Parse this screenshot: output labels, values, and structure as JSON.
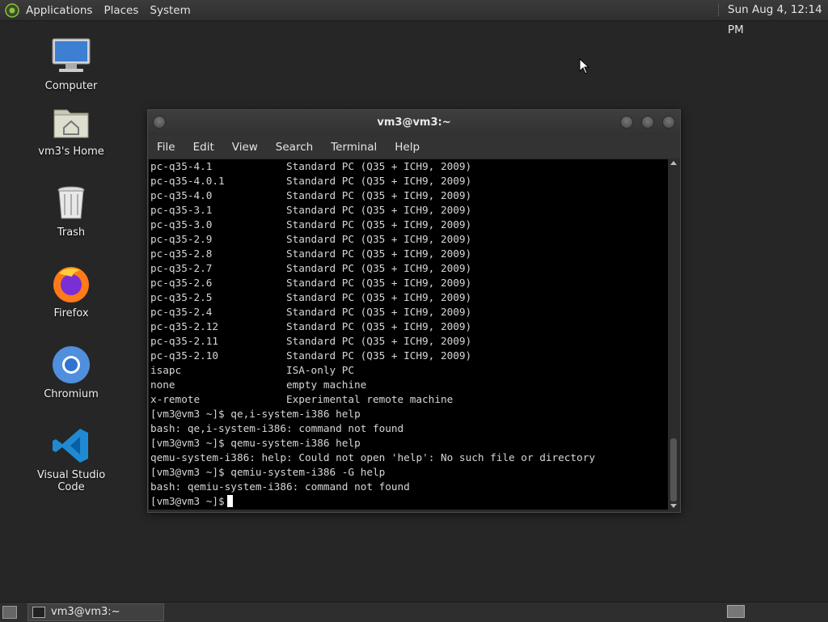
{
  "top_panel": {
    "menus": [
      "Applications",
      "Places",
      "System"
    ],
    "clock": "Sun Aug  4, 12:14 PM"
  },
  "desktop_icons": [
    {
      "label": "Computer",
      "icon": "computer-icon"
    },
    {
      "label": "vm3's Home",
      "icon": "home-folder-icon"
    },
    {
      "label": "Trash",
      "icon": "trash-icon"
    },
    {
      "label": "Firefox",
      "icon": "firefox-icon"
    },
    {
      "label": "Chromium",
      "icon": "chromium-icon"
    },
    {
      "label": "Visual Studio Code",
      "icon": "vscode-icon"
    }
  ],
  "terminal": {
    "title": "vm3@vm3:~",
    "menu": [
      "File",
      "Edit",
      "View",
      "Search",
      "Terminal",
      "Help"
    ],
    "table_rows": [
      [
        "pc-q35-4.1",
        "Standard PC (Q35 + ICH9, 2009)"
      ],
      [
        "pc-q35-4.0.1",
        "Standard PC (Q35 + ICH9, 2009)"
      ],
      [
        "pc-q35-4.0",
        "Standard PC (Q35 + ICH9, 2009)"
      ],
      [
        "pc-q35-3.1",
        "Standard PC (Q35 + ICH9, 2009)"
      ],
      [
        "pc-q35-3.0",
        "Standard PC (Q35 + ICH9, 2009)"
      ],
      [
        "pc-q35-2.9",
        "Standard PC (Q35 + ICH9, 2009)"
      ],
      [
        "pc-q35-2.8",
        "Standard PC (Q35 + ICH9, 2009)"
      ],
      [
        "pc-q35-2.7",
        "Standard PC (Q35 + ICH9, 2009)"
      ],
      [
        "pc-q35-2.6",
        "Standard PC (Q35 + ICH9, 2009)"
      ],
      [
        "pc-q35-2.5",
        "Standard PC (Q35 + ICH9, 2009)"
      ],
      [
        "pc-q35-2.4",
        "Standard PC (Q35 + ICH9, 2009)"
      ],
      [
        "pc-q35-2.12",
        "Standard PC (Q35 + ICH9, 2009)"
      ],
      [
        "pc-q35-2.11",
        "Standard PC (Q35 + ICH9, 2009)"
      ],
      [
        "pc-q35-2.10",
        "Standard PC (Q35 + ICH9, 2009)"
      ],
      [
        "isapc",
        "ISA-only PC"
      ],
      [
        "none",
        "empty machine"
      ],
      [
        "x-remote",
        "Experimental remote machine"
      ]
    ],
    "output_lines": [
      "[vm3@vm3 ~]$ qe,i-system-i386 help",
      "bash: qe,i-system-i386: command not found",
      "[vm3@vm3 ~]$ qemu-system-i386 help",
      "qemu-system-i386: help: Could not open 'help': No such file or directory",
      "[vm3@vm3 ~]$ qemiu-system-i386 -G help",
      "bash: qemiu-system-i386: command not found"
    ],
    "prompt": "[vm3@vm3 ~]$"
  },
  "taskbar": {
    "task_label": "vm3@vm3:~"
  }
}
